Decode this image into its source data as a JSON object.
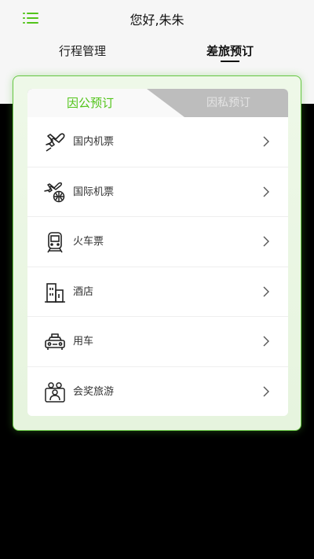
{
  "header": {
    "title": "您好,朱朱",
    "tabs": [
      {
        "label": "行程管理"
      },
      {
        "label": "差旅预订"
      }
    ]
  },
  "booking": {
    "segments": [
      {
        "label": "因公预订"
      },
      {
        "label": "因私预订"
      }
    ],
    "items": [
      {
        "label": "国内机票",
        "icon": "airplane-icon"
      },
      {
        "label": "国际机票",
        "icon": "international-flight-icon"
      },
      {
        "label": "火车票",
        "icon": "train-icon"
      },
      {
        "label": "酒店",
        "icon": "hotel-building-icon"
      },
      {
        "label": "用车",
        "icon": "taxi-icon"
      },
      {
        "label": "会奖旅游",
        "icon": "group-travel-icon"
      }
    ]
  },
  "colors": {
    "accent": "#52c41a",
    "border": "#66c742",
    "header_bg": "#f6f6f6",
    "inactive_tab": "#bdbdbd"
  }
}
